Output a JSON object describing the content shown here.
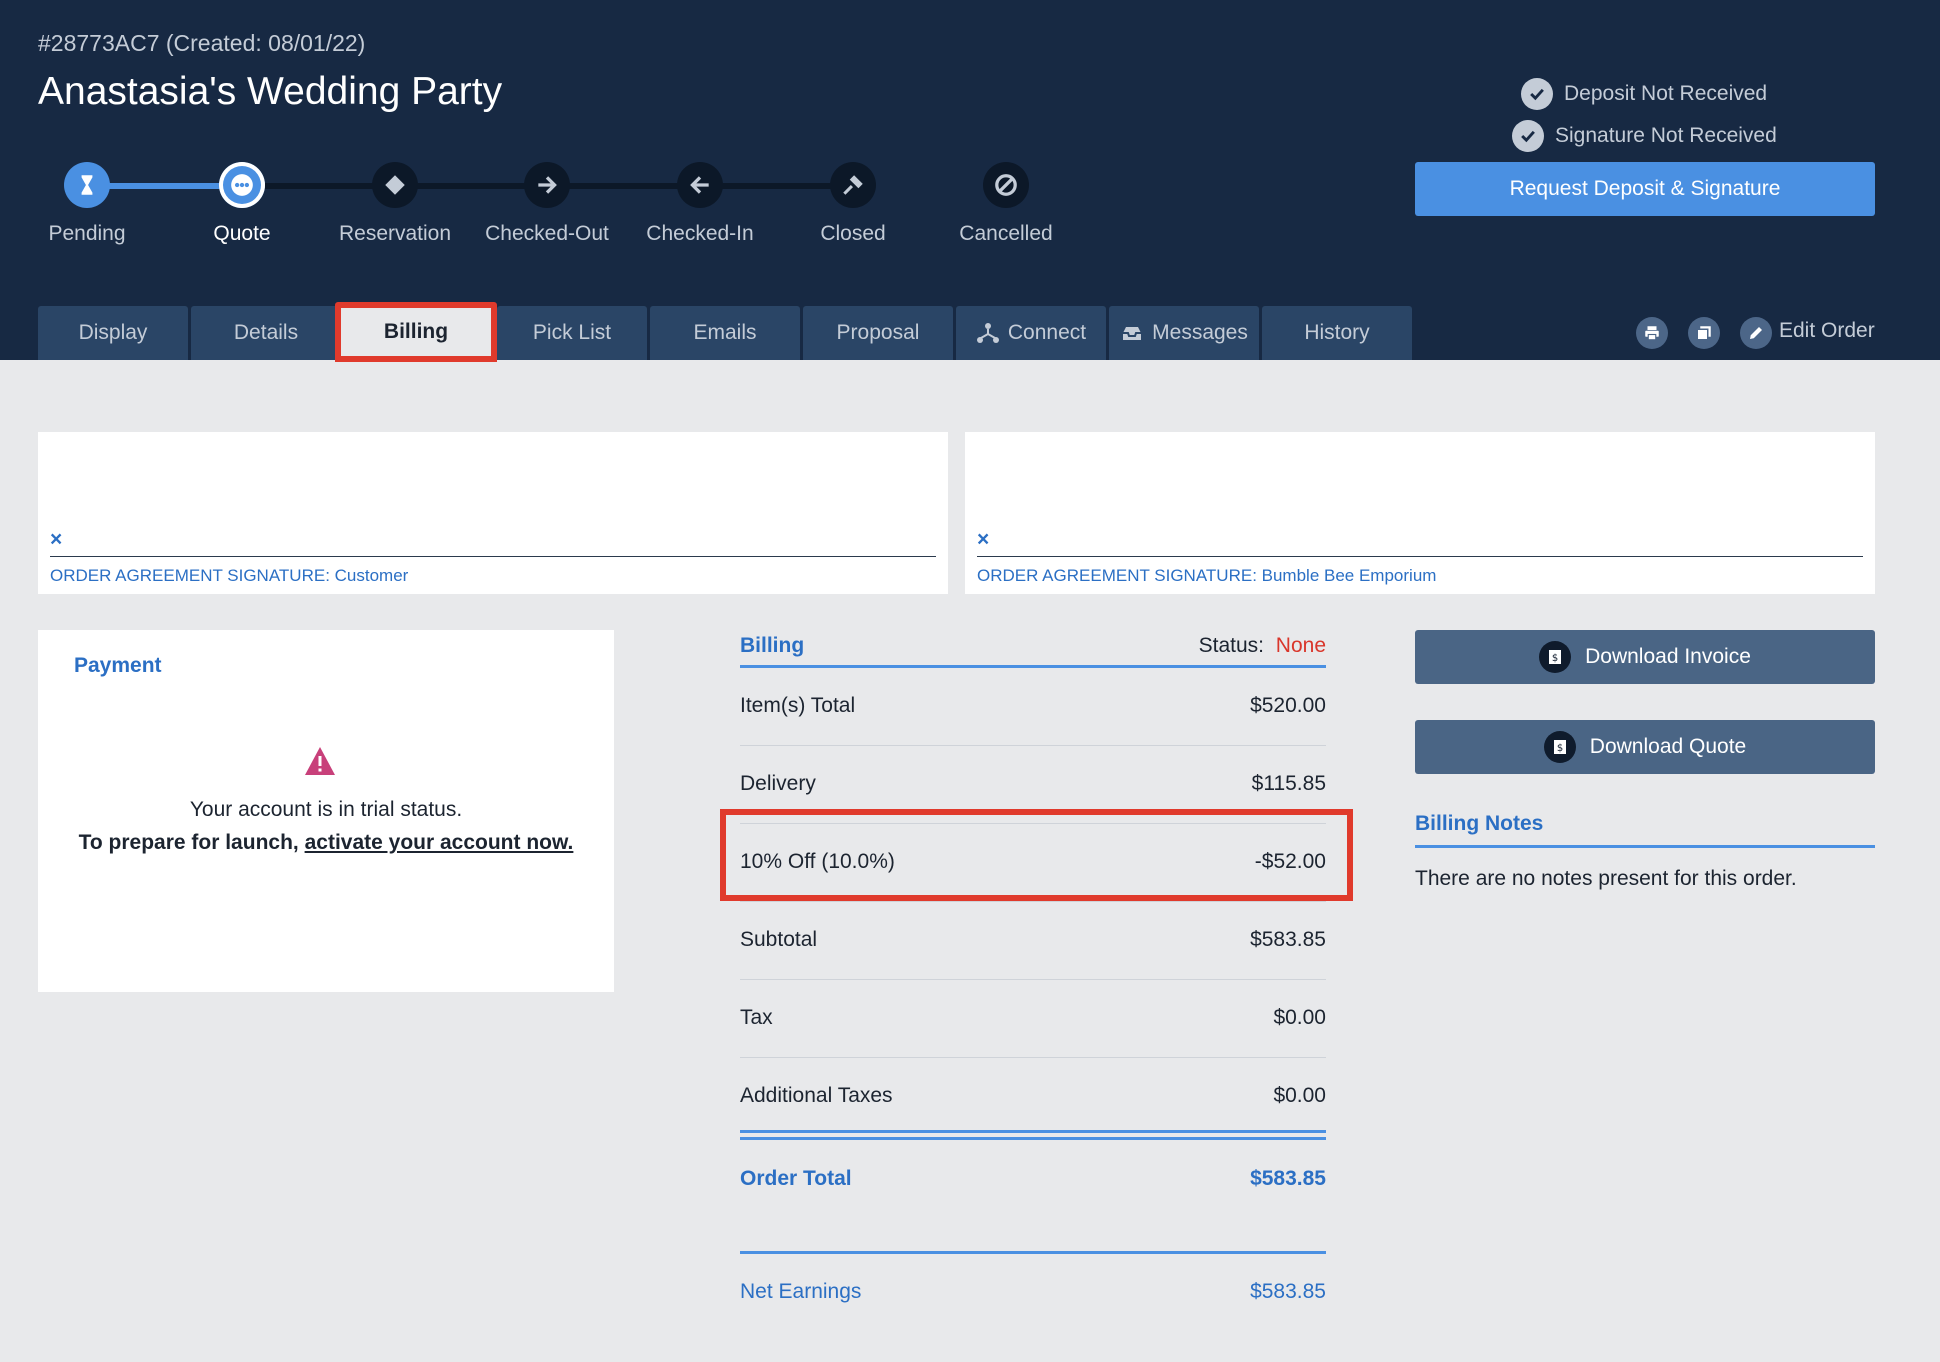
{
  "order": {
    "id_line": "#28773AC7 (Created: 08/01/22)",
    "title": "Anastasia's Wedding Party"
  },
  "steps": [
    {
      "label": "Pending",
      "state": "done",
      "icon": "hourglass-icon"
    },
    {
      "label": "Quote",
      "state": "current",
      "icon": "ellipsis-icon"
    },
    {
      "label": "Reservation",
      "state": "todo",
      "icon": "ticket-icon"
    },
    {
      "label": "Checked-Out",
      "state": "todo",
      "icon": "arrow-right-icon"
    },
    {
      "label": "Checked-In",
      "state": "todo",
      "icon": "arrow-left-icon"
    },
    {
      "label": "Closed",
      "state": "todo",
      "icon": "gavel-icon"
    },
    {
      "label": "Cancelled",
      "state": "todo",
      "icon": "ban-icon"
    }
  ],
  "status_checks": {
    "deposit": "Deposit Not Received",
    "signature": "Signature Not Received"
  },
  "request_button": "Request Deposit & Signature",
  "tabs": [
    {
      "label": "Display"
    },
    {
      "label": "Details"
    },
    {
      "label": "Billing",
      "active": true
    },
    {
      "label": "Pick List"
    },
    {
      "label": "Emails"
    },
    {
      "label": "Proposal"
    },
    {
      "label": "Connect",
      "icon": "network-icon"
    },
    {
      "label": "Messages",
      "icon": "inbox-icon"
    },
    {
      "label": "History"
    }
  ],
  "toolbar": {
    "edit_label": "Edit Order",
    "icons": [
      "print-icon",
      "copy-icon",
      "pencil-icon"
    ]
  },
  "signatures": {
    "mark": "×",
    "customer": "ORDER AGREEMENT SIGNATURE: Customer",
    "company": "ORDER AGREEMENT SIGNATURE: Bumble Bee Emporium"
  },
  "payment": {
    "title": "Payment",
    "trial_text": "Your account is in trial status.",
    "launch_text": "To prepare for launch,",
    "launch_link": "activate your account now."
  },
  "billing": {
    "title": "Billing",
    "status_label": "Status:",
    "status_value": "None",
    "rows": [
      {
        "label": "Item(s) Total",
        "value": "$520.00"
      },
      {
        "label": "Delivery",
        "value": "$115.85"
      },
      {
        "label": "10% Off (10.0%)",
        "value": "-$52.00"
      },
      {
        "label": "Subtotal",
        "value": "$583.85"
      },
      {
        "label": "Tax",
        "value": "$0.00"
      },
      {
        "label": "Additional Taxes",
        "value": "$0.00"
      }
    ],
    "order_total_label": "Order Total",
    "order_total_value": "$583.85",
    "net_label": "Net Earnings",
    "net_value": "$583.85"
  },
  "downloads": {
    "invoice": "Download Invoice",
    "quote": "Download Quote"
  },
  "notes": {
    "title": "Billing Notes",
    "empty_text": "There are no notes present for this order."
  },
  "colors": {
    "header_bg": "#172943",
    "accent": "#4a90e2",
    "highlight": "#e03a2c",
    "status_none": "#d9362b"
  }
}
